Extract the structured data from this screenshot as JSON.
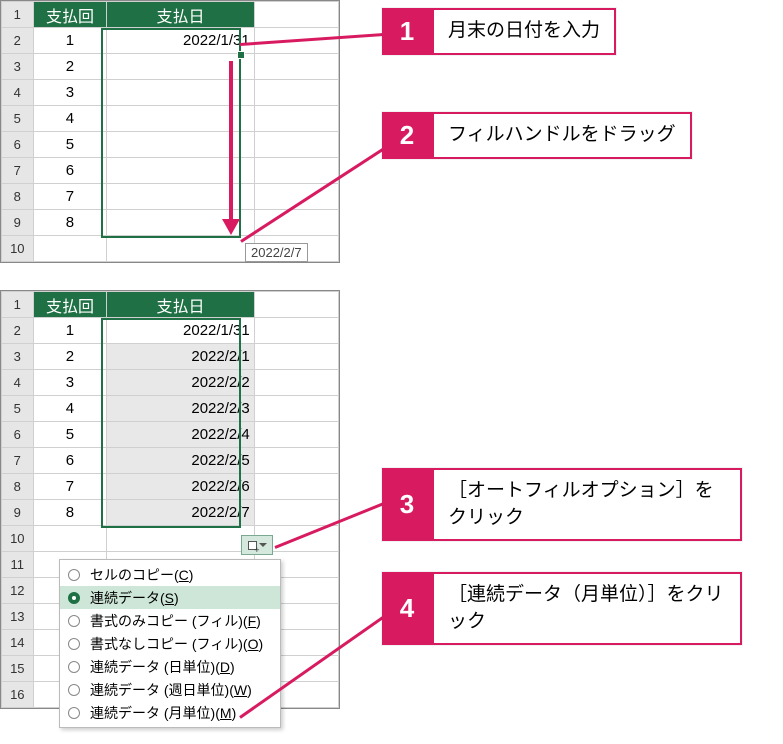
{
  "sheet1": {
    "headers": {
      "A": "支払回",
      "B": "支払日"
    },
    "rows": [
      {
        "n": "1",
        "a": "1",
        "b": "2022/1/31"
      },
      {
        "n": "2",
        "a": "2",
        "b": ""
      },
      {
        "n": "3",
        "a": "3",
        "b": ""
      },
      {
        "n": "4",
        "a": "4",
        "b": ""
      },
      {
        "n": "5",
        "a": "5",
        "b": ""
      },
      {
        "n": "6",
        "a": "6",
        "b": ""
      },
      {
        "n": "7",
        "a": "7",
        "b": ""
      },
      {
        "n": "8",
        "a": "8",
        "b": ""
      },
      {
        "n": "9",
        "a": "",
        "b": ""
      }
    ],
    "tooltip": "2022/2/7"
  },
  "sheet2": {
    "headers": {
      "A": "支払回",
      "B": "支払日"
    },
    "rows": [
      {
        "n": "1",
        "a": "1",
        "b": "2022/1/31"
      },
      {
        "n": "2",
        "a": "2",
        "b": "2022/2/1"
      },
      {
        "n": "3",
        "a": "3",
        "b": "2022/2/2"
      },
      {
        "n": "4",
        "a": "4",
        "b": "2022/2/3"
      },
      {
        "n": "5",
        "a": "5",
        "b": "2022/2/4"
      },
      {
        "n": "6",
        "a": "6",
        "b": "2022/2/5"
      },
      {
        "n": "7",
        "a": "7",
        "b": "2022/2/6"
      },
      {
        "n": "8",
        "a": "8",
        "b": "2022/2/7"
      },
      {
        "n": "9",
        "a": "",
        "b": ""
      },
      {
        "n": "10",
        "a": "",
        "b": ""
      },
      {
        "n": "11",
        "a": "",
        "b": ""
      },
      {
        "n": "12",
        "a": "",
        "b": ""
      },
      {
        "n": "13",
        "a": "",
        "b": ""
      },
      {
        "n": "14",
        "a": "",
        "b": ""
      },
      {
        "n": "15",
        "a": "",
        "b": ""
      },
      {
        "n": "16",
        "a": "",
        "b": ""
      }
    ]
  },
  "menu": {
    "items": [
      {
        "label": "セルのコピー(",
        "key": "C",
        "suffix": ")"
      },
      {
        "label": "連続データ(",
        "key": "S",
        "suffix": ")",
        "selected": true
      },
      {
        "label": "書式のみコピー (フィル)(",
        "key": "F",
        "suffix": ")"
      },
      {
        "label": "書式なしコピー (フィル)(",
        "key": "O",
        "suffix": ")"
      },
      {
        "label": "連続データ (日単位)(",
        "key": "D",
        "suffix": ")"
      },
      {
        "label": "連続データ (週日単位)(",
        "key": "W",
        "suffix": ")"
      },
      {
        "label": "連続データ (月単位)(",
        "key": "M",
        "suffix": ")"
      }
    ]
  },
  "callouts": {
    "c1": {
      "num": "1",
      "text": "月末の日付を入力"
    },
    "c2": {
      "num": "2",
      "text": "フィルハンドルをドラッグ"
    },
    "c3": {
      "num": "3",
      "text": "［オートフィルオプション］をクリック"
    },
    "c4": {
      "num": "4",
      "text": "［連続データ（月単位）］をクリック"
    }
  }
}
